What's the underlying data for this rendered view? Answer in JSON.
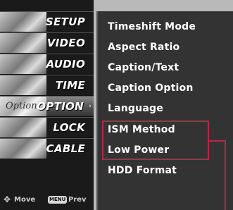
{
  "left_menu": {
    "items": [
      {
        "label": "SETUP",
        "thumb_text": ""
      },
      {
        "label": "VIDEO",
        "thumb_text": ""
      },
      {
        "label": "AUDIO",
        "thumb_text": ""
      },
      {
        "label": "TIME",
        "thumb_text": ""
      },
      {
        "label": "OPTION",
        "thumb_text": "Option",
        "active": true,
        "arrow": "›"
      },
      {
        "label": "LOCK",
        "thumb_text": ""
      },
      {
        "label": "CABLE",
        "thumb_text": ""
      }
    ]
  },
  "footer": {
    "move_label": "Move",
    "menu_badge": "MENU",
    "prev_label": "Prev"
  },
  "option_menu": {
    "items": [
      "Timeshift Mode",
      "Aspect Ratio",
      "Caption/Text",
      "Caption Option",
      "Language",
      "ISM Method",
      "Low Power",
      "HDD Format"
    ]
  },
  "colors": {
    "highlight": "#b12a4a"
  }
}
